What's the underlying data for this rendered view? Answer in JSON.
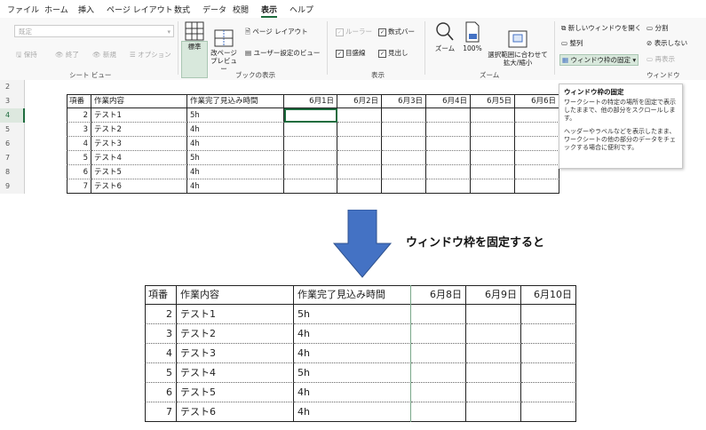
{
  "menu": [
    "ファイル",
    "ホーム",
    "挿入",
    "ページ レイアウト",
    "数式",
    "データ",
    "校閲",
    "表示",
    "ヘルプ"
  ],
  "menu_active": "表示",
  "sheetview": {
    "dropdown_value": "既定",
    "buttons": [
      "保持",
      "終了",
      "新規",
      "オプション"
    ],
    "label": "シート ビュー"
  },
  "bookview": {
    "normal": "標準",
    "pagebreak": "改ページ\nプレビュー",
    "pagelayout": "ページ レイアウト",
    "custom": "ユーザー設定のビュー",
    "label": "ブックの表示"
  },
  "show": {
    "ruler": "ルーラー",
    "formulabar": "数式バー",
    "gridlines": "目盛線",
    "headings": "見出し",
    "label": "表示"
  },
  "zoom": {
    "zoom": "ズーム",
    "percent": "100%",
    "fit": "選択範囲に合わせて\n拡大/縮小",
    "label": "ズーム"
  },
  "window": {
    "newwindow": "新しいウィンドウを開く",
    "arrange": "整列",
    "freeze": "ウィンドウ枠の固定",
    "split": "分割",
    "hide": "表示しない",
    "unhide": "再表示",
    "label": "ウィンドウ"
  },
  "tooltip": {
    "title": "ウィンドウ枠の固定",
    "p1": "ワークシートの特定の場所を固定で表示したままで、他の部分をスクロールします。",
    "p2": "ヘッダーやラベルなどを表示したまま、ワークシートの他の部分のデータをチェックする場合に便利です。"
  },
  "sheet": {
    "row_numbers": [
      "2",
      "3",
      "4",
      "5",
      "6",
      "7",
      "8",
      "9"
    ],
    "headers": [
      "項番",
      "作業内容",
      "作業完了見込み時間",
      "6月1日",
      "6月2日",
      "6月3日",
      "6月4日",
      "6月5日",
      "6月6日"
    ],
    "rows": [
      [
        "2",
        "テスト1",
        "5h"
      ],
      [
        "3",
        "テスト2",
        "4h"
      ],
      [
        "4",
        "テスト3",
        "4h"
      ],
      [
        "5",
        "テスト4",
        "5h"
      ],
      [
        "6",
        "テスト5",
        "4h"
      ],
      [
        "7",
        "テスト6",
        "4h"
      ]
    ]
  },
  "caption": "ウィンドウ枠を固定すると",
  "result": {
    "headers": [
      "項番",
      "作業内容",
      "作業完了見込み時間",
      "6月8日",
      "6月9日",
      "6月10日"
    ],
    "rows": [
      [
        "2",
        "テスト1",
        "5h"
      ],
      [
        "3",
        "テスト2",
        "4h"
      ],
      [
        "4",
        "テスト3",
        "4h"
      ],
      [
        "5",
        "テスト4",
        "5h"
      ],
      [
        "6",
        "テスト5",
        "4h"
      ],
      [
        "7",
        "テスト6",
        "4h"
      ]
    ]
  },
  "colors": {
    "accent": "#1e6c3e",
    "arrow": "#4472c4"
  }
}
